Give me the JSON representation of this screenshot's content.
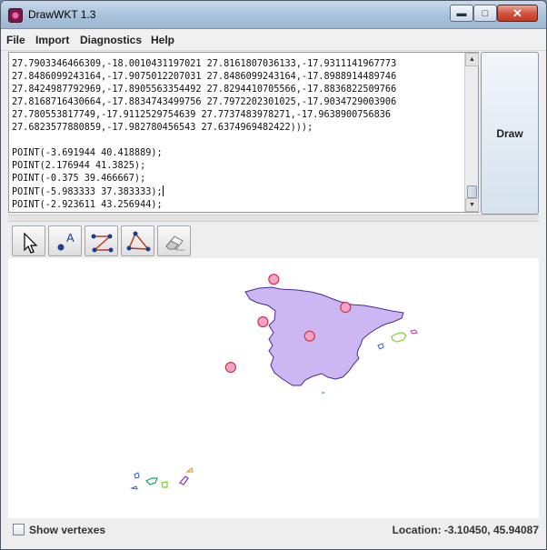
{
  "window": {
    "title": "DrawWKT 1.3"
  },
  "menu": [
    "File",
    "Import",
    "Diagnostics",
    "Help"
  ],
  "editor": {
    "lines": [
      "27.7903346466309,-18.0010431197021 27.8161807036133,-17.9311141967773",
      "27.8486099243164,-17.9075012207031 27.8486099243164,-17.8988914489746",
      "27.8424987792969,-17.8905563354492 27.8294410705566,-17.8836822509766",
      "27.8168716430664,-17.8834743499756 27.7972202301025,-17.9034729003906",
      "27.780553817749,-17.9112529754639 27.7737483978271,-17.9638900756836",
      "27.6823577880859,-17.982780456543 27.6374969482422)));",
      "",
      "POINT(-3.691944 40.418889);",
      "POINT(2.176944 41.3825);",
      "POINT(-0.375 39.466667);",
      "POINT(-5.983333 37.383333);",
      "POINT(-2.923611 43.256944);"
    ]
  },
  "draw_button": "Draw",
  "tools": [
    "pointer-tool",
    "add-point-label-tool",
    "line-tool",
    "polygon-tool",
    "eraser-tool"
  ],
  "status": {
    "show_vertexes": "Show vertexes",
    "location": "Location: -3.10450, 45.94087"
  },
  "map": {
    "polygon_fill": "#cdb7f2",
    "outline_color": "#4a2a9a",
    "point_fill": "#f3a3c6",
    "point_stroke": "#d0344a",
    "points": [
      {
        "lon": -3.691944,
        "lat": 40.418889
      },
      {
        "lon": 2.176944,
        "lat": 41.3825
      },
      {
        "lon": -0.375,
        "lat": 39.466667
      },
      {
        "lon": -5.983333,
        "lat": 37.383333
      },
      {
        "lon": -2.923611,
        "lat": 43.256944
      }
    ]
  }
}
